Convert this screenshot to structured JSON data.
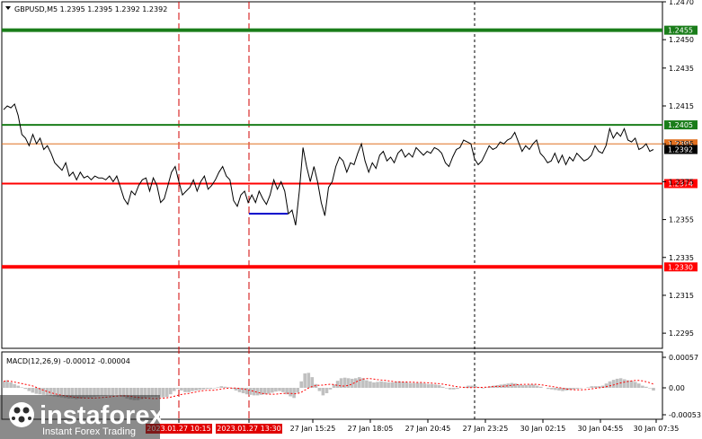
{
  "header": {
    "symbol_info": "GBPUSD,M5  1.2395 1.2395 1.2392 1.2392"
  },
  "macd": {
    "label": "MACD(12,26,9) -0.00012 -0.00004",
    "ticks": [
      "0.00057",
      "0.00",
      "-0.00053"
    ]
  },
  "watermark": {
    "brand": "instaforex",
    "tagline": "Instant Forex Trading"
  },
  "colors": {
    "green_line": "#1a7d1a",
    "red_line": "#ff0000",
    "price_line": "#e07020",
    "macd_hist": "#c0c0c0",
    "macd_signal": "#ff0000",
    "vline_red": "#d00000"
  },
  "chart_data": {
    "type": "line",
    "symbol": "GBPUSD",
    "timeframe": "M5",
    "ylim": [
      1.2287,
      1.247
    ],
    "y_ticks": [
      "1.2470",
      "1.2450",
      "1.2435",
      "1.2415",
      "1.2395",
      "1.2375",
      "1.2355",
      "1.2335",
      "1.2315",
      "1.2295"
    ],
    "x_ticks": [
      "2023.01.27 10:15",
      "2023.01.27 13:30",
      "27 Jan 15:25",
      "27 Jan 18:05",
      "27 Jan 20:45",
      "27 Jan 23:25",
      "30 Jan 02:15",
      "30 Jan 04:55",
      "30 Jan 07:35"
    ],
    "levels": [
      {
        "value": "1.2455",
        "kind": "resistance",
        "color": "#1a7d1a"
      },
      {
        "value": "1.2405",
        "kind": "resistance",
        "color": "#1a7d1a"
      },
      {
        "value": "1.2395",
        "kind": "current",
        "color": "#e07020"
      },
      {
        "value": "1.2392",
        "kind": "last",
        "color": "#000000"
      },
      {
        "value": "1.2374",
        "kind": "support",
        "color": "#ff0000"
      },
      {
        "value": "1.2330",
        "kind": "support",
        "color": "#ff0000"
      }
    ],
    "series": [
      {
        "values": [
          1.2413,
          1.2415,
          1.2414,
          1.2416,
          1.241,
          1.24,
          1.2398,
          1.2394,
          1.24,
          1.2395,
          1.2398,
          1.2392,
          1.2394,
          1.239,
          1.2385,
          1.2383,
          1.2381,
          1.2385,
          1.2378,
          1.238,
          1.2376,
          1.238,
          1.2377,
          1.2378,
          1.2376,
          1.2378,
          1.2377,
          1.2377,
          1.2376,
          1.2378,
          1.2375,
          1.2378,
          1.2372,
          1.2366,
          1.2363,
          1.237,
          1.2368,
          1.2373,
          1.2376,
          1.2377,
          1.237,
          1.2377,
          1.2373,
          1.2364,
          1.2366,
          1.2373,
          1.238,
          1.2383,
          1.2375,
          1.2368,
          1.237,
          1.2372,
          1.2376,
          1.237,
          1.2375,
          1.2378,
          1.2371,
          1.2373,
          1.2376,
          1.238,
          1.2383,
          1.2378,
          1.2376,
          1.2365,
          1.2362,
          1.2368,
          1.237,
          1.2364,
          1.2368,
          1.2364,
          1.237,
          1.2366,
          1.2363,
          1.2368,
          1.2376,
          1.2371,
          1.2375,
          1.237,
          1.2358,
          1.236,
          1.2352,
          1.237,
          1.2393,
          1.2383,
          1.2375,
          1.2383,
          1.2375,
          1.2364,
          1.2357,
          1.2372,
          1.2375,
          1.2383,
          1.2388,
          1.2386,
          1.238,
          1.2385,
          1.2384,
          1.239,
          1.2395,
          1.2386,
          1.238,
          1.2385,
          1.2382,
          1.2389,
          1.2391,
          1.2386,
          1.2388,
          1.2385,
          1.239,
          1.2392,
          1.2388,
          1.239,
          1.2388,
          1.2393,
          1.2391,
          1.2389,
          1.2391,
          1.239,
          1.2393,
          1.2392,
          1.239,
          1.2385,
          1.2383,
          1.2388,
          1.2392,
          1.2393,
          1.2397,
          1.2396,
          1.2395,
          1.2387,
          1.2384,
          1.2386,
          1.239,
          1.2394,
          1.2392,
          1.2393,
          1.2396,
          1.2395,
          1.2397,
          1.2398,
          1.2401,
          1.2396,
          1.2391,
          1.2394,
          1.2392,
          1.2395,
          1.2397,
          1.239,
          1.2388,
          1.2385,
          1.2386,
          1.239,
          1.2385,
          1.2389,
          1.2384,
          1.2388,
          1.2386,
          1.239,
          1.2388,
          1.2386,
          1.2387,
          1.2389,
          1.2394,
          1.2391,
          1.239,
          1.2394,
          1.2403,
          1.2398,
          1.2401,
          1.2399,
          1.2403,
          1.2397,
          1.2396,
          1.2398,
          1.2392,
          1.2393,
          1.2395,
          1.2391,
          1.2392
        ]
      }
    ],
    "macd_values": [
      0.00012,
      0.00014,
      0.0001,
      7e-05,
      4e-05,
      1e-05,
      -2e-05,
      -6e-05,
      -9e-05,
      -0.00011,
      -0.00012,
      -0.00013,
      -0.00014,
      -0.00015,
      -0.00016,
      -0.00017,
      -0.00018,
      -0.00019,
      -0.0002,
      -0.0002,
      -0.00021,
      -0.0002,
      -0.00019,
      -0.00018,
      -0.00018,
      -0.00017,
      -0.00016,
      -0.00015,
      -0.00015,
      -0.00014,
      -0.00014,
      -0.00013,
      -0.00014,
      -0.00017,
      -0.0002,
      -0.00022,
      -0.00023,
      -0.00023,
      -0.00021,
      -0.00019,
      -0.00018,
      -0.00017,
      -0.00017,
      -0.00018,
      -0.00018,
      -0.00017,
      -0.00012,
      -6e-05,
      -2e-05,
      -5e-05,
      -8e-05,
      -8e-05,
      -6e-05,
      -5e-05,
      -4e-05,
      -3e-05,
      -2e-05,
      -2e-05,
      -1e-05,
      1e-05,
      3e-05,
      2e-05,
      1e-05,
      -2e-05,
      -5e-05,
      -8e-05,
      -0.0001,
      -0.00012,
      -0.00013,
      -0.00014,
      -0.00014,
      -0.00013,
      -0.00012,
      -0.00011,
      -9e-05,
      -7e-05,
      -6e-05,
      -8e-05,
      -0.00012,
      -0.00016,
      -0.00019,
      -9e-05,
      0.00012,
      0.00027,
      0.00028,
      0.0002,
      7e-05,
      -6e-05,
      -0.00014,
      -0.0001,
      -3e-05,
      6e-05,
      0.00013,
      0.00018,
      0.00019,
      0.00018,
      0.00017,
      0.00018,
      0.0002,
      0.00018,
      0.00014,
      0.00012,
      0.0001,
      0.00011,
      0.00012,
      0.00011,
      0.0001,
      0.0001,
      0.00011,
      0.00012,
      0.00011,
      0.0001,
      9e-05,
      9e-05,
      9e-05,
      9e-05,
      8e-05,
      7e-05,
      7e-05,
      6e-05,
      5e-05,
      2e-05,
      -1e-05,
      -3e-05,
      -3e-05,
      -2e-05,
      0.0,
      2e-05,
      4e-05,
      4e-05,
      3e-05,
      1e-05,
      -1e-05,
      1e-05,
      3e-05,
      4e-05,
      5e-05,
      6e-05,
      7e-05,
      8e-05,
      9e-05,
      8e-05,
      6e-05,
      5e-05,
      5e-05,
      6e-05,
      6e-05,
      4e-05,
      2e-05,
      0.0,
      -2e-05,
      -3e-05,
      -4e-05,
      -5e-05,
      -6e-05,
      -5e-05,
      -4e-05,
      -3e-05,
      -2e-05,
      -1e-05,
      0.0,
      1e-05,
      3e-05,
      3e-05,
      3e-05,
      4e-05,
      8e-05,
      0.00012,
      0.00015,
      0.00017,
      0.00018,
      0.00016,
      0.00014,
      0.00013,
      0.00011,
      8e-05,
      4e-05,
      2e-05,
      -1e-05,
      -5e-05
    ]
  }
}
